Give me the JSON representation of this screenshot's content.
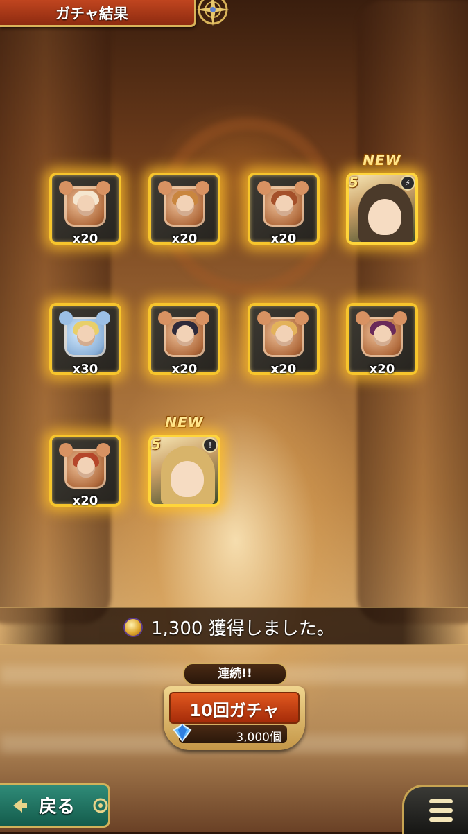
{
  "header": {
    "title": "ガチャ結果"
  },
  "results": [
    {
      "kind": "piece",
      "count": "x20",
      "tint": "warm"
    },
    {
      "kind": "piece",
      "count": "x20",
      "tint": "warm"
    },
    {
      "kind": "piece",
      "count": "x20",
      "tint": "warm"
    },
    {
      "kind": "unit",
      "new": "NEW",
      "rarity": "5",
      "element": "⚡"
    },
    {
      "kind": "piece",
      "count": "x30",
      "tint": "blue"
    },
    {
      "kind": "piece",
      "count": "x20",
      "tint": "warm"
    },
    {
      "kind": "piece",
      "count": "x20",
      "tint": "warm"
    },
    {
      "kind": "piece",
      "count": "x20",
      "tint": "warm"
    },
    {
      "kind": "piece",
      "count": "x20",
      "tint": "warm"
    },
    {
      "kind": "unit",
      "new": "NEW",
      "rarity": "5",
      "element": "!"
    }
  ],
  "reward": {
    "text": "1,300 獲得しました。"
  },
  "gacha": {
    "continue_label": "連続!!",
    "button_label": "10回ガチャ",
    "cost": "3,000個"
  },
  "footer": {
    "back_label": "戻る"
  },
  "colors": {
    "glow": "#ffbe28",
    "frame": "#f7c52c",
    "back_button": "#2f8b78",
    "gacha_button": "#e0581f"
  },
  "icons": {
    "currency": "coin-icon",
    "gem": "diamond-icon",
    "menu": "hamburger-menu-icon"
  }
}
